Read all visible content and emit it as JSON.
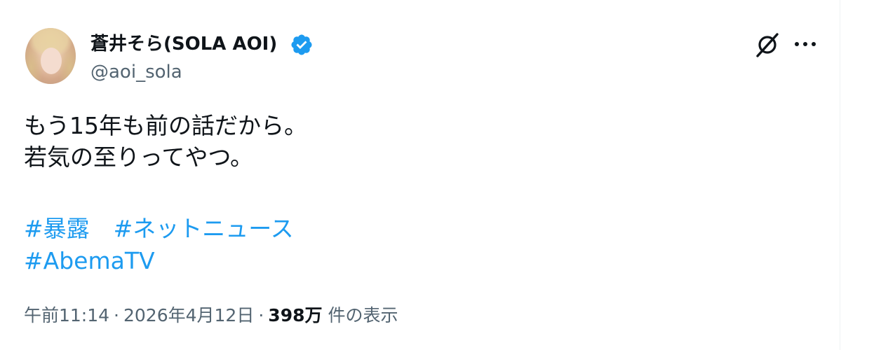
{
  "author": {
    "display_name": "蒼井そら(SOLA AOI)",
    "handle": "@aoi_sola",
    "verified": true
  },
  "tweet": {
    "lines": [
      "もう15年も前の話だから。",
      "若気の至りってやつ。"
    ],
    "hashtags": [
      "#暴露",
      "#ネットニュース",
      "#AbemaTV"
    ]
  },
  "meta": {
    "time": "午前11:14",
    "separator": "·",
    "date": "2026年4月12日",
    "views_count": "398万",
    "views_label": "件の表示"
  },
  "colors": {
    "text": "#0f1419",
    "secondary": "#536471",
    "link": "#1d9bf0",
    "verified": "#1d9bf0"
  },
  "icons": {
    "verified": "verified-badge-icon",
    "grok": "grok-icon",
    "more": "more-horizontal-icon"
  }
}
